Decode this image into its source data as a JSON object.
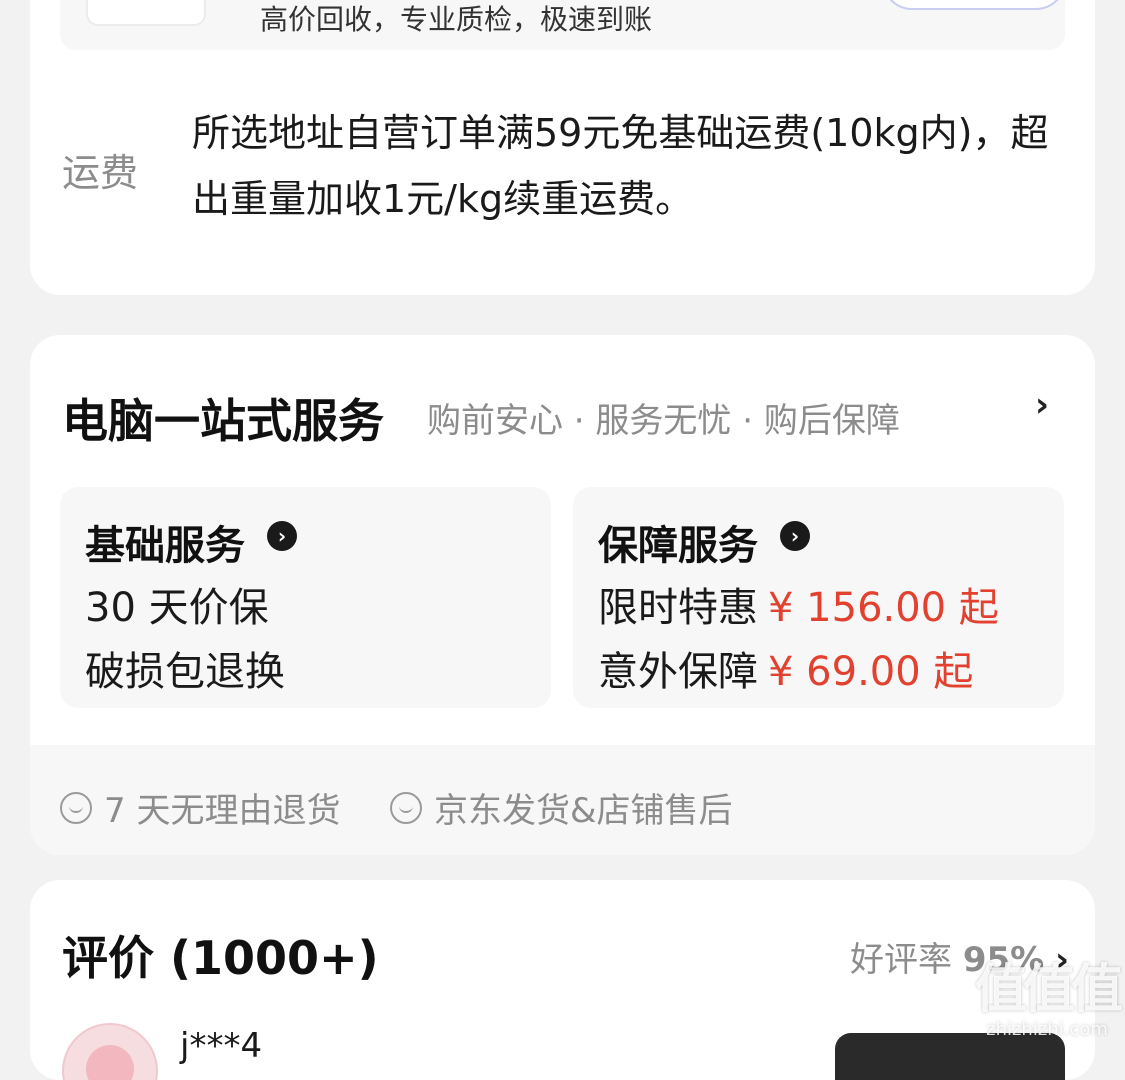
{
  "trade_in": {
    "text": "高价回收，专业质检，极速到账"
  },
  "shipping": {
    "label": "运费",
    "text": "所选地址自营订单满59元免基础运费(10kg内)，超出重量加收1元/kg续重运费。"
  },
  "services": {
    "title": "电脑一站式服务",
    "subtitle": "购前安心 · 服务无忧 · 购后保障",
    "arrow": "›",
    "basic": {
      "title": "基础服务",
      "info_icon": "›",
      "items": [
        "30 天价保",
        "破损包退换"
      ]
    },
    "protection": {
      "title": "保障服务",
      "info_icon": "›",
      "items": [
        {
          "name": "限时特惠",
          "price": "¥ 156.00 起"
        },
        {
          "name": "意外保障",
          "price": "¥ 69.00 起"
        }
      ]
    },
    "guarantees": [
      "7 天无理由退货",
      "京东发货&店铺售后"
    ],
    "price_color": "#e2412f"
  },
  "reviews": {
    "title": "评价 (1000+)",
    "rate_label": "好评率",
    "rate_value": "95%",
    "arrow": "›",
    "first_user": "j***4"
  },
  "watermark": {
    "logo": "值值值",
    "domain": "zhizhizhi.com"
  }
}
